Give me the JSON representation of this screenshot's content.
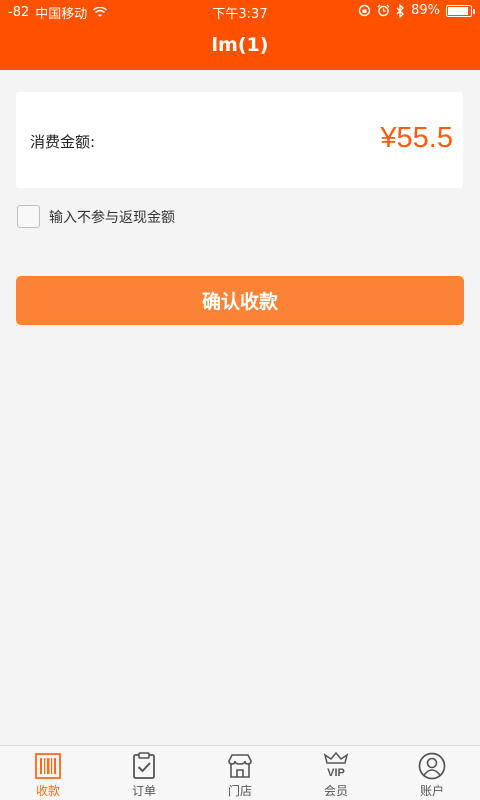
{
  "status_bar": {
    "signal": "-82",
    "carrier": "中国移动",
    "time": "下午3:37",
    "battery_percent": "89%",
    "battery_level": 0.89
  },
  "header": {
    "title": "lm(1)"
  },
  "amount": {
    "label": "消费金额:",
    "value": "¥55.5"
  },
  "exclude": {
    "label": "输入不参与返现金额",
    "checked": false
  },
  "confirm_button": {
    "label": "确认收款"
  },
  "tabs": [
    {
      "label": "收款",
      "icon": "barcode-icon",
      "active": true
    },
    {
      "label": "订单",
      "icon": "clipboard-check-icon",
      "active": false
    },
    {
      "label": "门店",
      "icon": "store-icon",
      "active": false
    },
    {
      "label": "会员",
      "icon": "vip-crown-icon",
      "active": false
    },
    {
      "label": "账户",
      "icon": "user-circle-icon",
      "active": false
    }
  ],
  "colors": {
    "header": "#ff5100",
    "accent": "#ff5a0a",
    "button": "#fc8335",
    "background": "#f4f4f4"
  }
}
